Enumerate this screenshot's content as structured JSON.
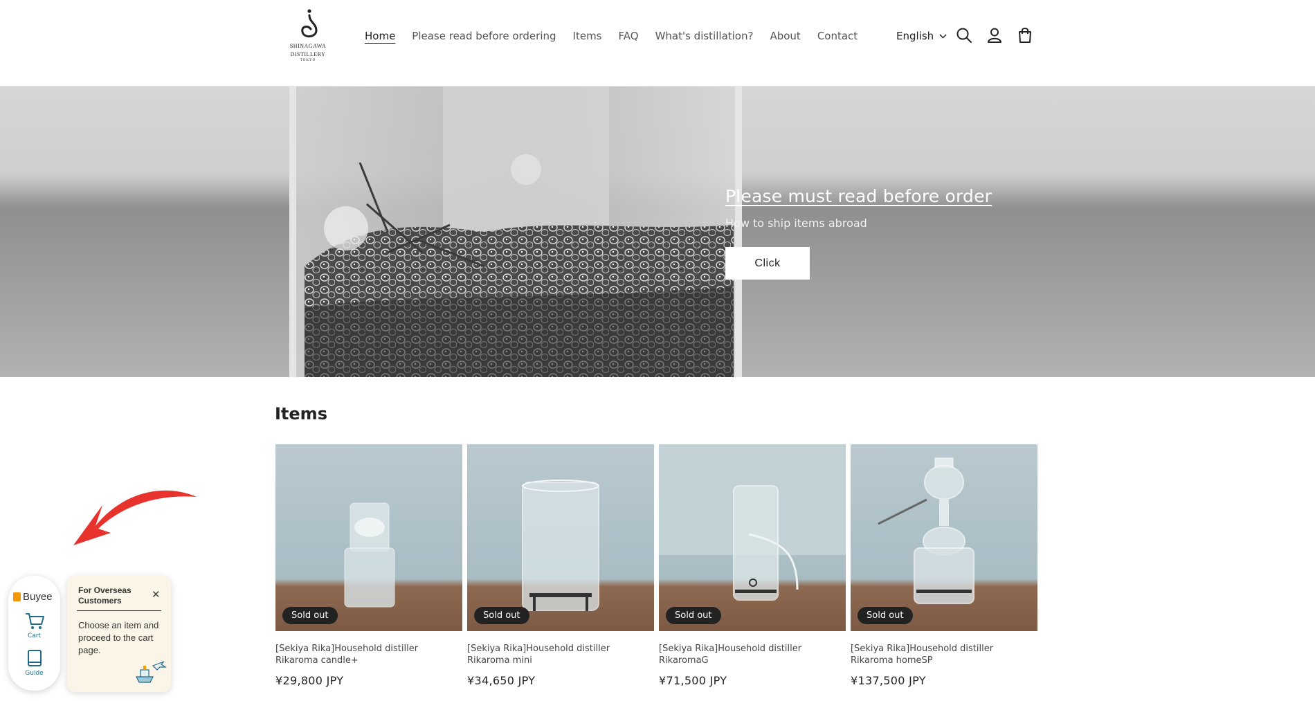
{
  "brand": {
    "name": "SHINAGAWA DISTILLERY",
    "line1": "SHINAGAWA",
    "line2": "DISTILLERY",
    "line3": "TOKYO"
  },
  "nav": [
    {
      "label": "Home",
      "active": true
    },
    {
      "label": "Please read before ordering"
    },
    {
      "label": "Items"
    },
    {
      "label": "FAQ"
    },
    {
      "label": "What's distillation?"
    },
    {
      "label": "About"
    },
    {
      "label": "Contact"
    }
  ],
  "header": {
    "language": "English"
  },
  "hero": {
    "title": "Please must read before order",
    "subtitle": "How to ship items abroad",
    "button": "Click"
  },
  "items": {
    "heading": "Items",
    "products": [
      {
        "name": "[Sekiya Rika]Household distiller Rikaroma candle+",
        "price": "¥29,800 JPY",
        "badge": "Sold out"
      },
      {
        "name": "[Sekiya Rika]Household distiller Rikaroma mini",
        "price": "¥34,650 JPY",
        "badge": "Sold out"
      },
      {
        "name": "[Sekiya Rika]Household distiller RikaromaG",
        "price": "¥71,500 JPY",
        "badge": "Sold out"
      },
      {
        "name": "[Sekiya Rika]Household distiller Rikaroma homeSP",
        "price": "¥137,500 JPY",
        "badge": "Sold out"
      }
    ]
  },
  "buyee": {
    "logo": "Buyee",
    "cart_label": "Cart",
    "guide_label": "Guide",
    "popup_title": "For Overseas Customers",
    "popup_text": "Choose an item and proceed to the cart page.",
    "accent": "#f39800"
  },
  "colors": {
    "arrow": "#e8322e",
    "badge": "#222222"
  }
}
